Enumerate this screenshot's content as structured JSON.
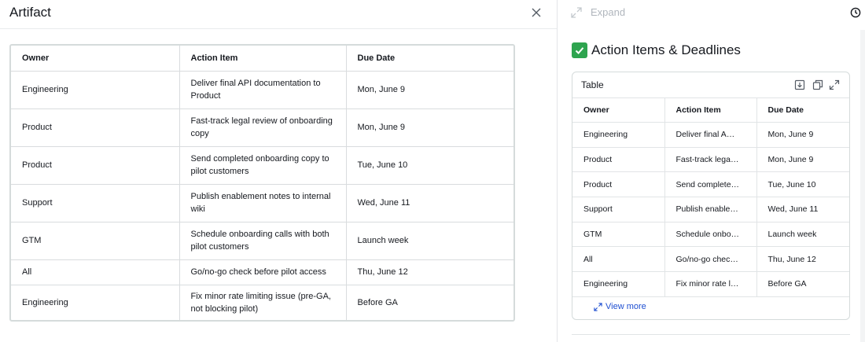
{
  "artifact": {
    "title": "Artifact",
    "close_icon": "close-icon",
    "table": {
      "headers": [
        "Owner",
        "Action Item",
        "Due Date"
      ],
      "rows": [
        [
          "Engineering",
          "Deliver final API documentation to Product",
          "Mon, June 9"
        ],
        [
          "Product",
          "Fast-track legal review of onboarding copy",
          "Mon, June 9"
        ],
        [
          "Product",
          "Send completed onboarding copy to pilot customers",
          "Tue, June 10"
        ],
        [
          "Support",
          "Publish enablement notes to internal wiki",
          "Wed, June 11"
        ],
        [
          "GTM",
          "Schedule onboarding calls with both pilot customers",
          "Launch week"
        ],
        [
          "All",
          "Go/no-go check before pilot access",
          "Thu, June 12"
        ],
        [
          "Engineering",
          "Fix minor rate limiting issue (pre-GA, not blocking pilot)",
          "Before GA"
        ]
      ]
    }
  },
  "chat": {
    "expand_label": "Expand",
    "expand_icon": "expand-arrows-icon",
    "history_icon": "clock-icon",
    "section_icon": "check-mark-icon",
    "section_title": "Action Items & Deadlines",
    "card": {
      "title": "Table",
      "icons": [
        "download-icon",
        "copy-icon",
        "expand-icon"
      ],
      "headers": [
        "Owner",
        "Action Item",
        "Due Date"
      ],
      "rows": [
        [
          "Engineering",
          "Deliver final A…",
          "Mon, June 9"
        ],
        [
          "Product",
          "Fast-track lega…",
          "Mon, June 9"
        ],
        [
          "Product",
          "Send complete…",
          "Tue, June 10"
        ],
        [
          "Support",
          "Publish enable…",
          "Wed, June 11"
        ],
        [
          "GTM",
          "Schedule onbo…",
          "Launch week"
        ],
        [
          "All",
          "Go/no-go chec…",
          "Thu, June 12"
        ],
        [
          "Engineering",
          "Fix minor rate l…",
          "Before GA"
        ]
      ],
      "view_more": "View more"
    }
  },
  "colors": {
    "accent_link": "#1f4fd1",
    "check_green": "#2ea44f",
    "border": "#d5dbdb",
    "muted_text": "#b0b6bd"
  }
}
